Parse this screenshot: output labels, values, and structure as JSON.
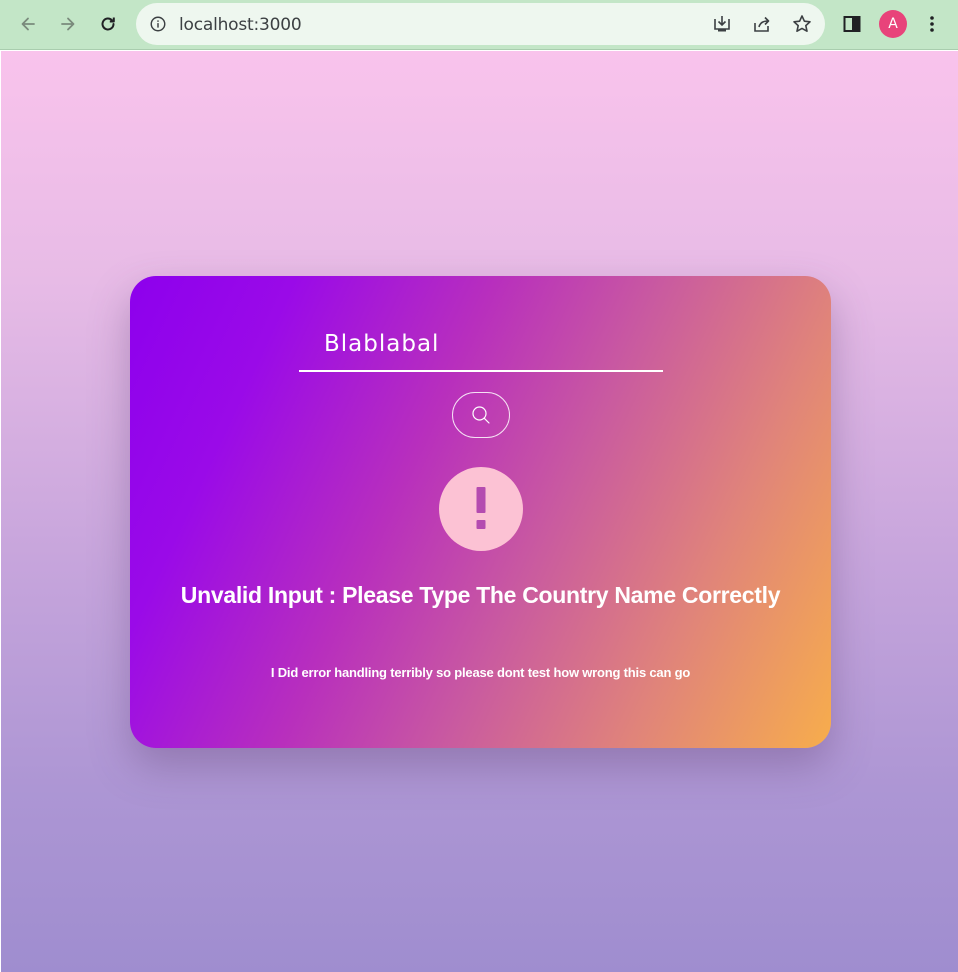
{
  "browser": {
    "url": "localhost:3000",
    "profile_initial": "A",
    "toolbar_bg": "#c3e6c7",
    "icons": [
      "back-icon",
      "forward-icon",
      "reload-icon",
      "site-info-icon",
      "install-icon",
      "share-icon",
      "bookmark-star-icon",
      "side-panel-icon",
      "menu-icon"
    ]
  },
  "search": {
    "value": "Blablabal",
    "button_icon": "search-icon"
  },
  "error": {
    "icon": "exclamation-icon",
    "title": "Unvalid Input : Please Type The Country Name Correctly",
    "note": "I Did error handling terribly so please dont test how wrong this can go"
  },
  "colors": {
    "card_gradient_start": "#8d00ed",
    "card_gradient_end": "#f7ad4c",
    "alert_circle": "#fcc2d4",
    "alert_mark": "#b44bb0",
    "avatar": "#e8437a"
  }
}
